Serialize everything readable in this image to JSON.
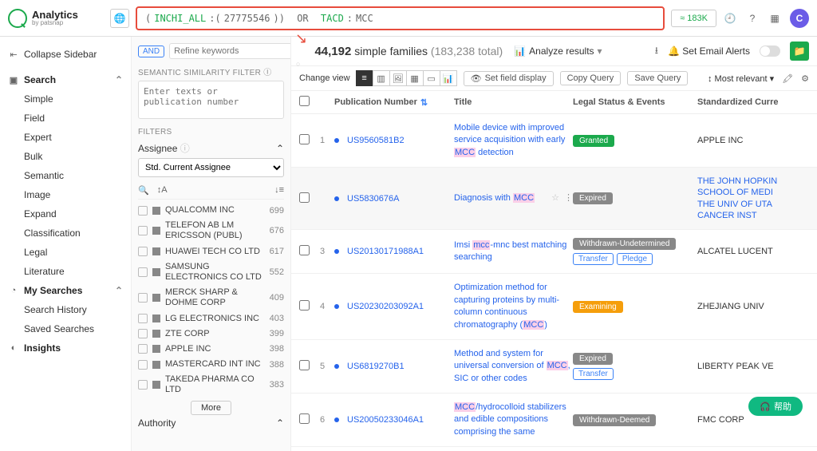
{
  "brand": {
    "name": "Analytics",
    "sub": "by patsnap"
  },
  "search": {
    "field1": "INCHI_ALL",
    "value1": "27775546",
    "op": "OR",
    "field2": "TACD",
    "value2": "MCC",
    "result_count": "≈ 183K"
  },
  "avatar": "C",
  "sidebar": {
    "collapse": "Collapse Sidebar",
    "search": {
      "label": "Search",
      "items": [
        "Simple",
        "Field",
        "Expert",
        "Bulk",
        "Semantic",
        "Image",
        "Expand",
        "Classification",
        "Legal",
        "Literature"
      ]
    },
    "mysearches": {
      "label": "My Searches",
      "items": [
        "Search History",
        "Saved Searches"
      ]
    },
    "insights": "Insights"
  },
  "filters": {
    "and": "AND",
    "refine_ph": "Refine keywords",
    "sem_label": "SEMANTIC SIMILARITY FILTER",
    "sem_ph": "Enter texts or publication number",
    "filters_label": "FILTERS",
    "assignee_label": "Assignee",
    "assignee_cat": "Std. Current Assignee",
    "assignees": [
      {
        "name": "QUALCOMM INC",
        "count": "699"
      },
      {
        "name": "TELEFON AB LM ERICSSON (PUBL)",
        "count": "676"
      },
      {
        "name": "HUAWEI TECH CO LTD",
        "count": "617"
      },
      {
        "name": "SAMSUNG ELECTRONICS CO LTD",
        "count": "552"
      },
      {
        "name": "MERCK SHARP & DOHME CORP",
        "count": "409"
      },
      {
        "name": "LG ELECTRONICS INC",
        "count": "403"
      },
      {
        "name": "ZTE CORP",
        "count": "399"
      },
      {
        "name": "APPLE INC",
        "count": "398"
      },
      {
        "name": "MASTERCARD INT INC",
        "count": "388"
      },
      {
        "name": "TAKEDA PHARMA CO LTD",
        "count": "383"
      }
    ],
    "more": "More",
    "authority": "Authority"
  },
  "results": {
    "count": "44,192",
    "count_label": "simple families",
    "total": "(183,238 total)",
    "analyze": "Analyze results",
    "set_email": "Set Email Alerts",
    "change_view": "Change view",
    "set_field": "Set field display",
    "copy_query": "Copy Query",
    "save_query": "Save Query",
    "sort": "Most relevant",
    "cols": {
      "pub": "Publication Number",
      "title": "Title",
      "status": "Legal Status & Events",
      "assignee": "Standardized Curre"
    },
    "rows": [
      {
        "n": "1",
        "pub": "US9560581B2",
        "title_pre": "Mobile device with improved service acquisition with early ",
        "hl": "MCC",
        "title_post": " detection",
        "badges": [
          {
            "t": "Granted",
            "c": "granted"
          }
        ],
        "obadges": [],
        "assignee": "APPLE INC",
        "assignee_black": true
      },
      {
        "n": "",
        "pub": "US5830676A",
        "title_pre": "Diagnosis with ",
        "hl": "MCC",
        "title_post": "",
        "star": true,
        "badges": [
          {
            "t": "Expired",
            "c": "expired"
          }
        ],
        "obadges": [],
        "assignee": "THE JOHN HOPKIN\nSCHOOL OF MEDI\nTHE UNIV OF UTA\nCANCER INST"
      },
      {
        "n": "3",
        "pub": "US20130171988A1",
        "title_pre": "Imsi ",
        "hl": "mcc",
        "title_post": "-mnc best matching searching",
        "badges": [
          {
            "t": "Withdrawn-Undetermined",
            "c": "withdrawn"
          }
        ],
        "obadges": [
          "Transfer",
          "Pledge"
        ],
        "assignee": "ALCATEL LUCENT",
        "assignee_black": true
      },
      {
        "n": "4",
        "pub": "US20230203092A1",
        "title_pre": "Optimization method for capturing proteins by multi-column continuous chromatography (",
        "hl": "MCC",
        "title_post": ")",
        "badges": [
          {
            "t": "Examining",
            "c": "exam"
          }
        ],
        "obadges": [],
        "assignee": "ZHEJIANG UNIV",
        "assignee_black": true
      },
      {
        "n": "5",
        "pub": "US6819270B1",
        "title_pre": "Method and system for universal conversion of ",
        "hl": "MCC",
        "title_post": ", SIC or other codes",
        "badges": [
          {
            "t": "Expired",
            "c": "expired"
          }
        ],
        "obadges": [
          "Transfer"
        ],
        "assignee": "LIBERTY PEAK VE",
        "assignee_black": true
      },
      {
        "n": "6",
        "pub": "US20050233046A1",
        "title_pre": "",
        "hl": "MCC",
        "title_post": "/hydrocolloid stabilizers and edible compositions comprising the same",
        "badges": [
          {
            "t": "Withdrawn-Deemed",
            "c": "withdrawn"
          }
        ],
        "obadges": [],
        "assignee": "FMC CORP",
        "assignee_black": true
      }
    ]
  },
  "help": "帮助"
}
